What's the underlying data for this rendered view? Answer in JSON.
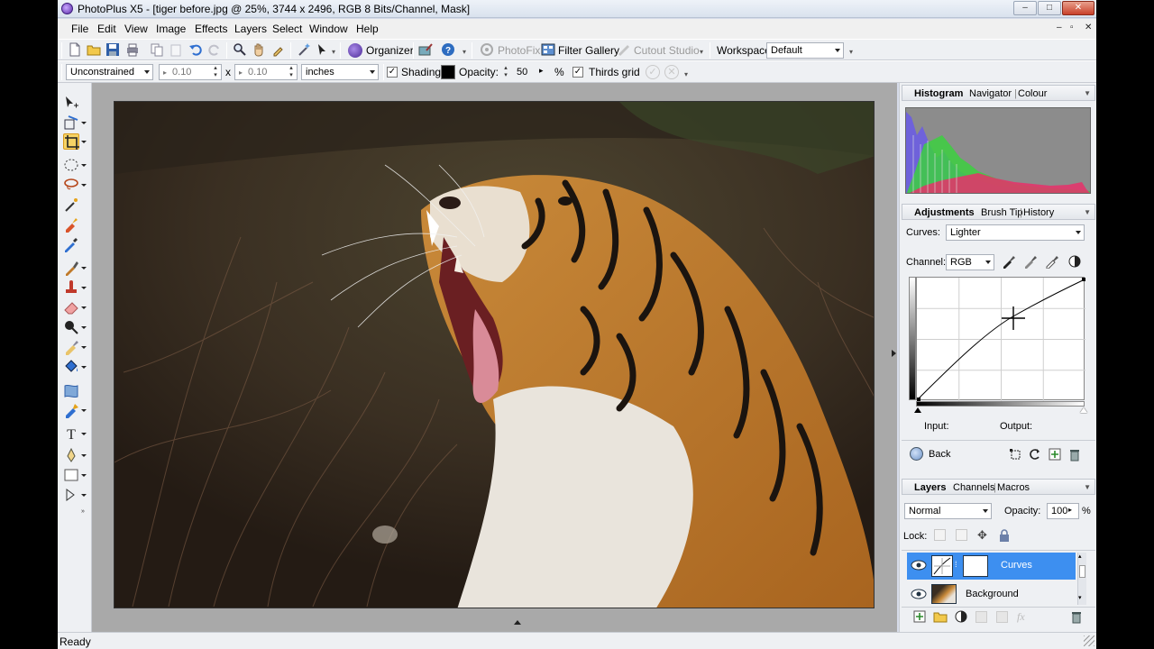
{
  "window": {
    "title": "PhotoPlus X5 - [tiger before.jpg @ 25%, 3744 x 2496, RGB 8 Bits/Channel, Mask]",
    "controls": [
      "–",
      "□",
      "✕"
    ],
    "mdi_controls": [
      "–",
      "▫",
      "✕"
    ]
  },
  "menu": [
    "File",
    "Edit",
    "View",
    "Image",
    "Effects",
    "Layers",
    "Select",
    "Window",
    "Help"
  ],
  "toolbar1": {
    "organizer_label": "Organizer",
    "photofix_label": "PhotoFix",
    "filter_gallery_label": "Filter Gallery",
    "cutout_studio_label": "Cutout Studio",
    "workspace_label": "Workspace",
    "workspace_value": "Default"
  },
  "toolbar2": {
    "constraint_value": "Unconstrained",
    "width_value": "0.10",
    "x_label": "x",
    "height_value": "0.10",
    "units_value": "inches",
    "shading_label": "Shading",
    "opacity_label": "Opacity:",
    "opacity_value": "50",
    "percent": "%",
    "thirds_grid_label": "Thirds grid"
  },
  "histogram_panel": {
    "tabs": [
      "Histogram",
      "Navigator",
      "Colour"
    ]
  },
  "adjustments_panel": {
    "tabs": [
      "Adjustments",
      "Brush Tip",
      "History"
    ],
    "curves_label": "Curves:",
    "curves_preset": "Lighter",
    "channel_label": "Channel:",
    "channel_value": "RGB",
    "input_label": "Input:",
    "output_label": "Output:",
    "back_label": "Back"
  },
  "layers_panel": {
    "tabs": [
      "Layers",
      "Channels",
      "Macros"
    ],
    "blend_mode": "Normal",
    "opacity_label": "Opacity:",
    "opacity_value": "100",
    "percent": "%",
    "lock_label": "Lock:",
    "layers": [
      {
        "name": "Curves",
        "selected": true
      },
      {
        "name": "Background",
        "selected": false
      }
    ]
  },
  "status": {
    "text": "Ready"
  },
  "colors": {
    "accent": "#3399ff",
    "selection": "#3d8ff0",
    "window_bg": "#d6dbe9"
  }
}
